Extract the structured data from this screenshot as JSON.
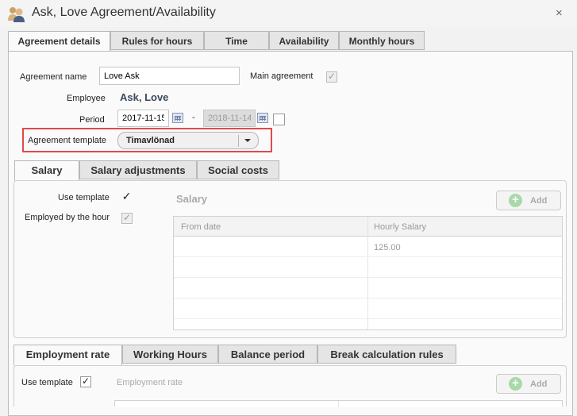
{
  "window": {
    "title": "Ask, Love Agreement/Availability",
    "close": "×"
  },
  "tabs": [
    "Agreement details",
    "Rules for hours",
    "Time",
    "Availability",
    "Monthly hours"
  ],
  "form": {
    "agreement_name_label": "Agreement name",
    "agreement_name_value": "Love Ask",
    "main_agreement_label": "Main agreement",
    "main_agreement_checked": "✓",
    "employee_label": "Employee",
    "employee_value": "Ask, Love",
    "period_label": "Period",
    "period_start": "2017-11-15",
    "period_sep": "-",
    "period_end": "2018-11-14",
    "template_label": "Agreement template",
    "template_value": "Timavlönad"
  },
  "salary_tabs": [
    "Salary",
    "Salary adjustments",
    "Social costs"
  ],
  "salary": {
    "use_template_label": "Use template",
    "use_template_checked": "✓",
    "employed_by_hour_label": "Employed by the hour",
    "employed_by_hour_checked": "✓",
    "section_title": "Salary",
    "add_label": "Add",
    "columns": [
      "From date",
      "Hourly Salary"
    ],
    "rows": [
      [
        "",
        "125.00"
      ]
    ]
  },
  "employment_tabs": [
    "Employment rate",
    "Working Hours",
    "Balance period",
    "Break calculation rules"
  ],
  "employment": {
    "use_template_label": "Use template",
    "use_template_checked": "✓",
    "section_title": "Employment rate",
    "add_label": "Add"
  },
  "colors": {
    "highlight": "#e04a4a",
    "add_plus": "#a9d9a9"
  }
}
